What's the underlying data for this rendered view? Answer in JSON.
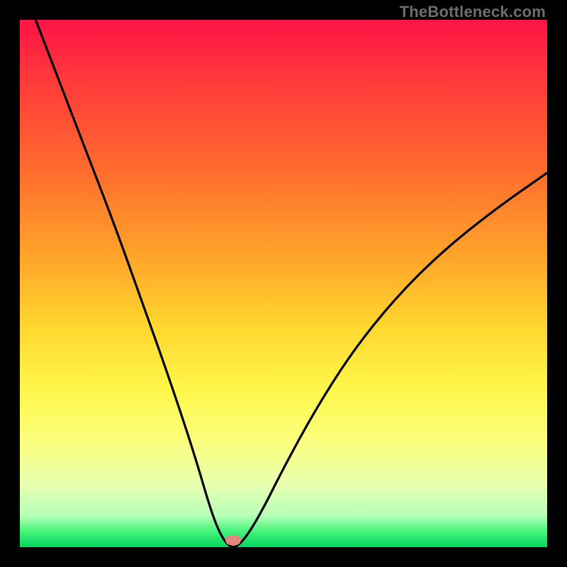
{
  "watermark": "TheBottleneck.com",
  "marker": {
    "name": "bottleneck-marker",
    "cx_frac": 0.405,
    "cy_frac": 0.987
  },
  "chart_data": {
    "type": "line",
    "title": "",
    "xlabel": "",
    "ylabel": "",
    "xlim": [
      0,
      1
    ],
    "ylim": [
      0,
      1
    ],
    "series": [
      {
        "name": "bottleneck-curve",
        "x": [
          0.03,
          0.08,
          0.13,
          0.18,
          0.23,
          0.28,
          0.33,
          0.365,
          0.385,
          0.4,
          0.41,
          0.43,
          0.46,
          0.5,
          0.56,
          0.63,
          0.71,
          0.8,
          0.9,
          1.0
        ],
        "y": [
          1.0,
          0.87,
          0.74,
          0.61,
          0.47,
          0.33,
          0.18,
          0.06,
          0.015,
          0.0,
          0.0,
          0.02,
          0.07,
          0.15,
          0.26,
          0.37,
          0.47,
          0.56,
          0.64,
          0.71
        ]
      }
    ],
    "gradient_stops": [
      {
        "pos": 0.0,
        "color": "#ff1446"
      },
      {
        "pos": 0.5,
        "color": "#ffd62e"
      },
      {
        "pos": 0.95,
        "color": "#b7ffb8"
      },
      {
        "pos": 1.0,
        "color": "#00d862"
      }
    ]
  }
}
